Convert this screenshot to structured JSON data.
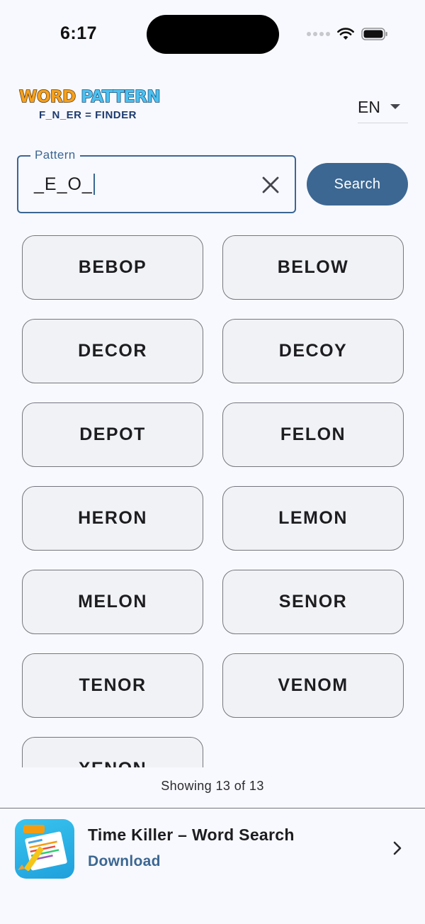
{
  "status_bar": {
    "time": "6:17"
  },
  "header": {
    "logo_line1_word1": "WORD",
    "logo_line1_word2": "PATTERN",
    "logo_line2": "F_N_ER = FINDER",
    "language": "EN"
  },
  "search": {
    "label": "Pattern",
    "value": "_E_O_",
    "button_label": "Search"
  },
  "results": [
    "BEBOP",
    "BELOW",
    "DECOR",
    "DECOY",
    "DEPOT",
    "FELON",
    "HERON",
    "LEMON",
    "MELON",
    "SENOR",
    "TENOR",
    "VENOM",
    "XENON"
  ],
  "footer": {
    "showing": "Showing 13 of 13"
  },
  "ad": {
    "title": "Time Killer – Word Search",
    "cta": "Download"
  },
  "colors": {
    "primary": "#3c6792",
    "background": "#f8f9fe",
    "card": "#f1f2f6",
    "card_border": "#76777e"
  }
}
